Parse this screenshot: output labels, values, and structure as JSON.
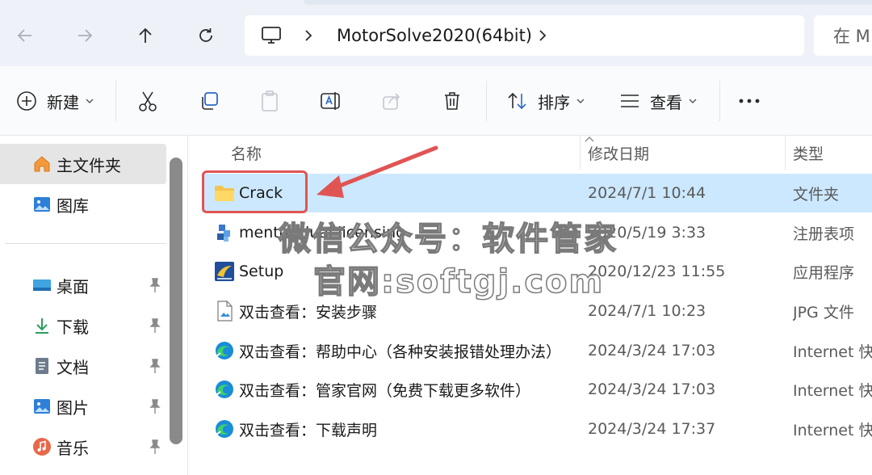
{
  "address": {
    "breadcrumb_folder": "MotorSolve2020(64bit)",
    "search_prefix": "在 M"
  },
  "toolbar": {
    "new_label": "新建",
    "sort_label": "排序",
    "view_label": "查看"
  },
  "sidebar": {
    "home_label": "主文件夹",
    "gallery_label": "图库",
    "items": [
      {
        "label": "桌面",
        "icon": "desktop-icon"
      },
      {
        "label": "下载",
        "icon": "download-icon"
      },
      {
        "label": "文档",
        "icon": "document-icon"
      },
      {
        "label": "图片",
        "icon": "pictures-icon"
      },
      {
        "label": "音乐",
        "icon": "music-icon"
      }
    ]
  },
  "columns": {
    "name": "名称",
    "date": "修改日期",
    "type": "类型"
  },
  "files": [
    {
      "name": "Crack",
      "date": "2024/7/1 10:44",
      "type": "文件夹",
      "icon": "folder-icon"
    },
    {
      "name": "mentor dual licensing",
      "date": "2020/5/19 3:33",
      "type": "注册表项",
      "icon": "registry-icon"
    },
    {
      "name": "Setup",
      "date": "2020/12/23 11:55",
      "type": "应用程序",
      "icon": "setup-icon"
    },
    {
      "name": "双击查看：安装步骤",
      "date": "2024/7/1 10:23",
      "type": "JPG 文件",
      "icon": "image-file-icon"
    },
    {
      "name": "双击查看：帮助中心（各种安装报错处理办法）",
      "date": "2024/3/24 17:03",
      "type": "Internet 快",
      "icon": "edge-icon"
    },
    {
      "name": "双击查看：管家官网（免费下载更多软件）",
      "date": "2024/3/24 17:03",
      "type": "Internet 快",
      "icon": "edge-icon"
    },
    {
      "name": "双击查看：下载声明",
      "date": "2024/3/24 17:37",
      "type": "Internet 快",
      "icon": "edge-icon"
    }
  ],
  "watermark": {
    "line1": "微信公众号：软件管家",
    "line2": "官网:softgj.com"
  },
  "colors": {
    "selection": "#cce8ff",
    "annotation": "#e15454",
    "folder": "#f4c24d"
  }
}
